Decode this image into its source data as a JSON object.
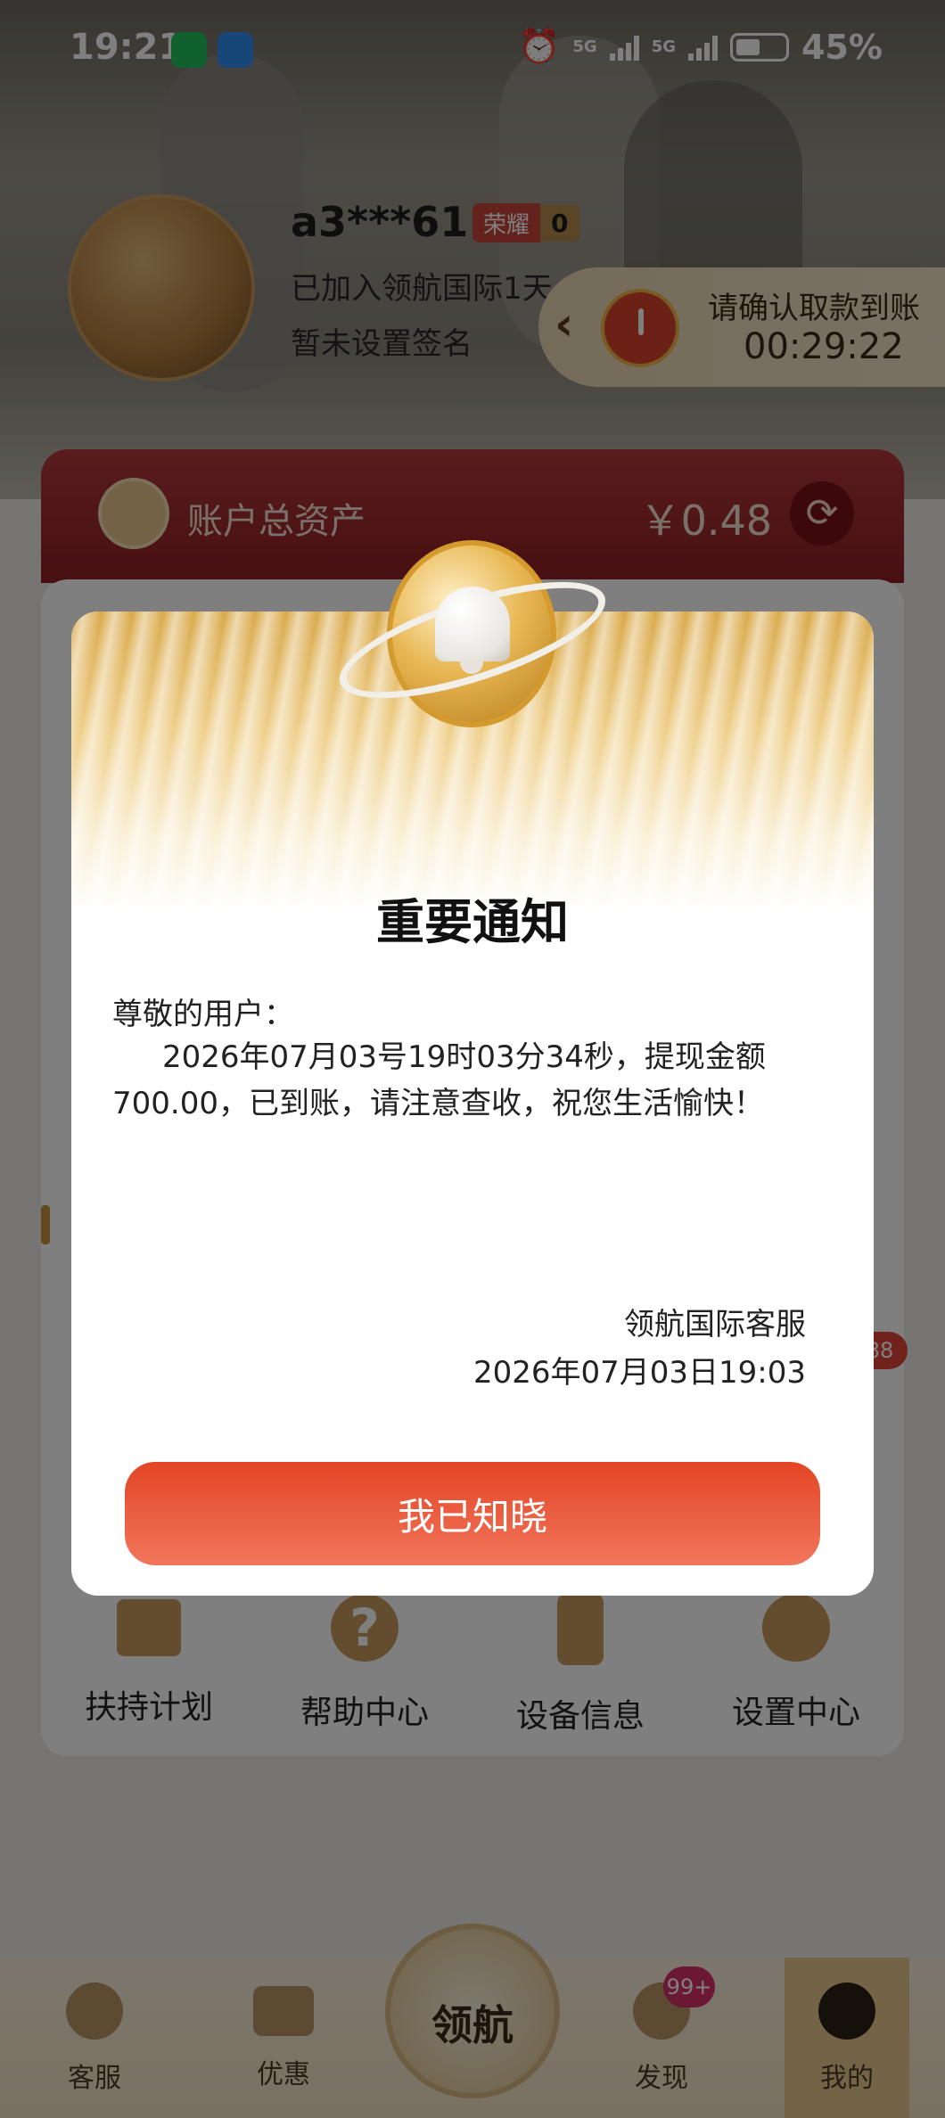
{
  "status_bar": {
    "time": "19:21",
    "signal_1": "5G",
    "signal_2": "5G",
    "battery": "45%"
  },
  "profile": {
    "username": "a3***61",
    "rank_name": "荣耀",
    "rank_count": "0",
    "joined_text": "已加入领航国际1天",
    "signature": "暂未设置签名"
  },
  "confirm_banner": {
    "title": "请确认取款到账",
    "countdown": "00:29:22"
  },
  "asset": {
    "label": "账户总资产",
    "amount": "￥0.48",
    "refresh_icon": "refresh-icon"
  },
  "behind_modal": {
    "badge_count": "88"
  },
  "grid": [
    {
      "label": "扶持计划",
      "icon": "gift-icon"
    },
    {
      "label": "帮助中心",
      "icon": "help-icon"
    },
    {
      "label": "设备信息",
      "icon": "device-icon"
    },
    {
      "label": "设置中心",
      "icon": "settings-icon"
    }
  ],
  "bottom_nav": {
    "items": [
      {
        "label": "客服",
        "icon": "chat-icon"
      },
      {
        "label": "优惠",
        "icon": "ticket-icon"
      },
      {
        "label": "发现",
        "icon": "compass-icon"
      },
      {
        "label": "我的",
        "icon": "user-icon"
      }
    ],
    "center_label": "领航",
    "discover_badge": "99+"
  },
  "modal": {
    "title": "重要通知",
    "greeting": "尊敬的用户：",
    "message": "2026年07月03号19时03分34秒，提现金额700.00，已到账，请注意查收，祝您生活愉快！",
    "signer": "领航国际客服",
    "date": "2026年07月03日19:03",
    "button": "我已知晓"
  },
  "colors": {
    "primary_red": "#e34525",
    "gold": "#c99a5c",
    "asset_card_red": "#9e262b"
  }
}
